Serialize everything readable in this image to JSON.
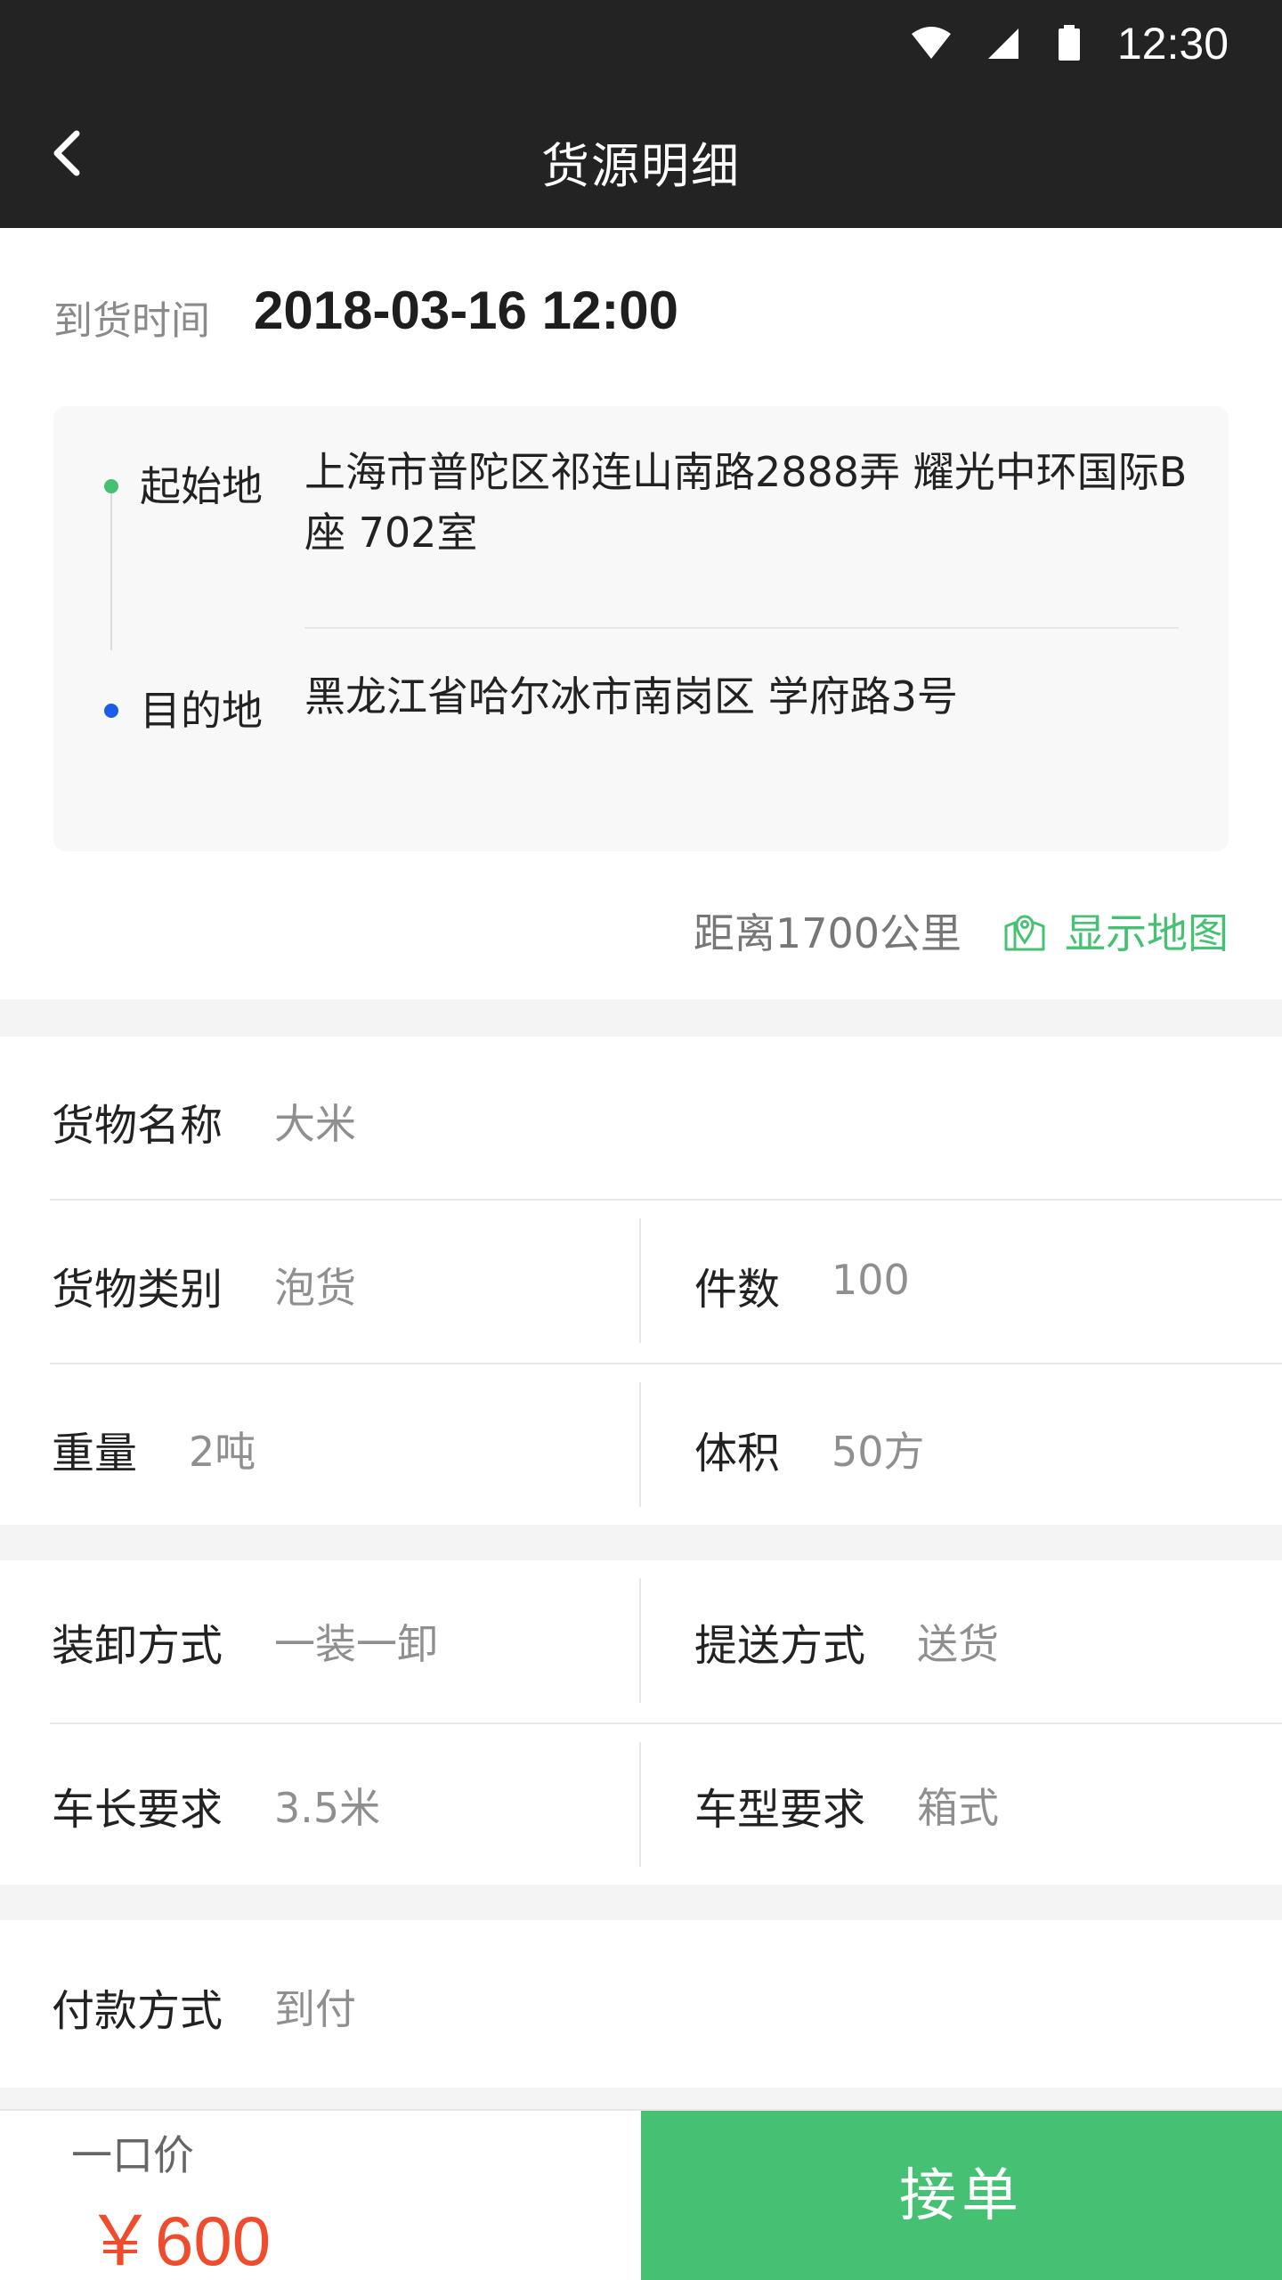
{
  "status_bar": {
    "time": "12:30"
  },
  "header": {
    "title": "货源明细"
  },
  "arrival": {
    "label": "到货时间",
    "datetime": "2018-03-16  12:00"
  },
  "route": {
    "origin_label": "起始地",
    "origin_address": "上海市普陀区祁连山南路2888弄 耀光中环国际B座 702室",
    "destination_label": "目的地",
    "destination_address": "黑龙江省哈尔冰市南岗区 学府路3号"
  },
  "distance": {
    "text": "距离1700公里",
    "map_link": "显示地图"
  },
  "cargo": {
    "name_label": "货物名称",
    "name_value": "大米",
    "type_label": "货物类别",
    "type_value": "泡货",
    "count_label": "件数",
    "count_value": "100",
    "weight_label": "重量",
    "weight_value": "2吨",
    "volume_label": "体积",
    "volume_value": "50方"
  },
  "handling": {
    "load_label": "装卸方式",
    "load_value": "一装一卸",
    "delivery_label": "提送方式",
    "delivery_value": "送货",
    "length_label": "车长要求",
    "length_value": "3.5米",
    "vehicle_label": "车型要求",
    "vehicle_value": "箱式"
  },
  "payment": {
    "label": "付款方式",
    "value": "到付"
  },
  "footer": {
    "price_label": "一口价",
    "price": "￥600",
    "accept_label": "接单"
  },
  "colors": {
    "accent": "#46c173",
    "price": "#ef4b2d",
    "dark": "#232323",
    "destination_dot": "#1a5ee6"
  }
}
